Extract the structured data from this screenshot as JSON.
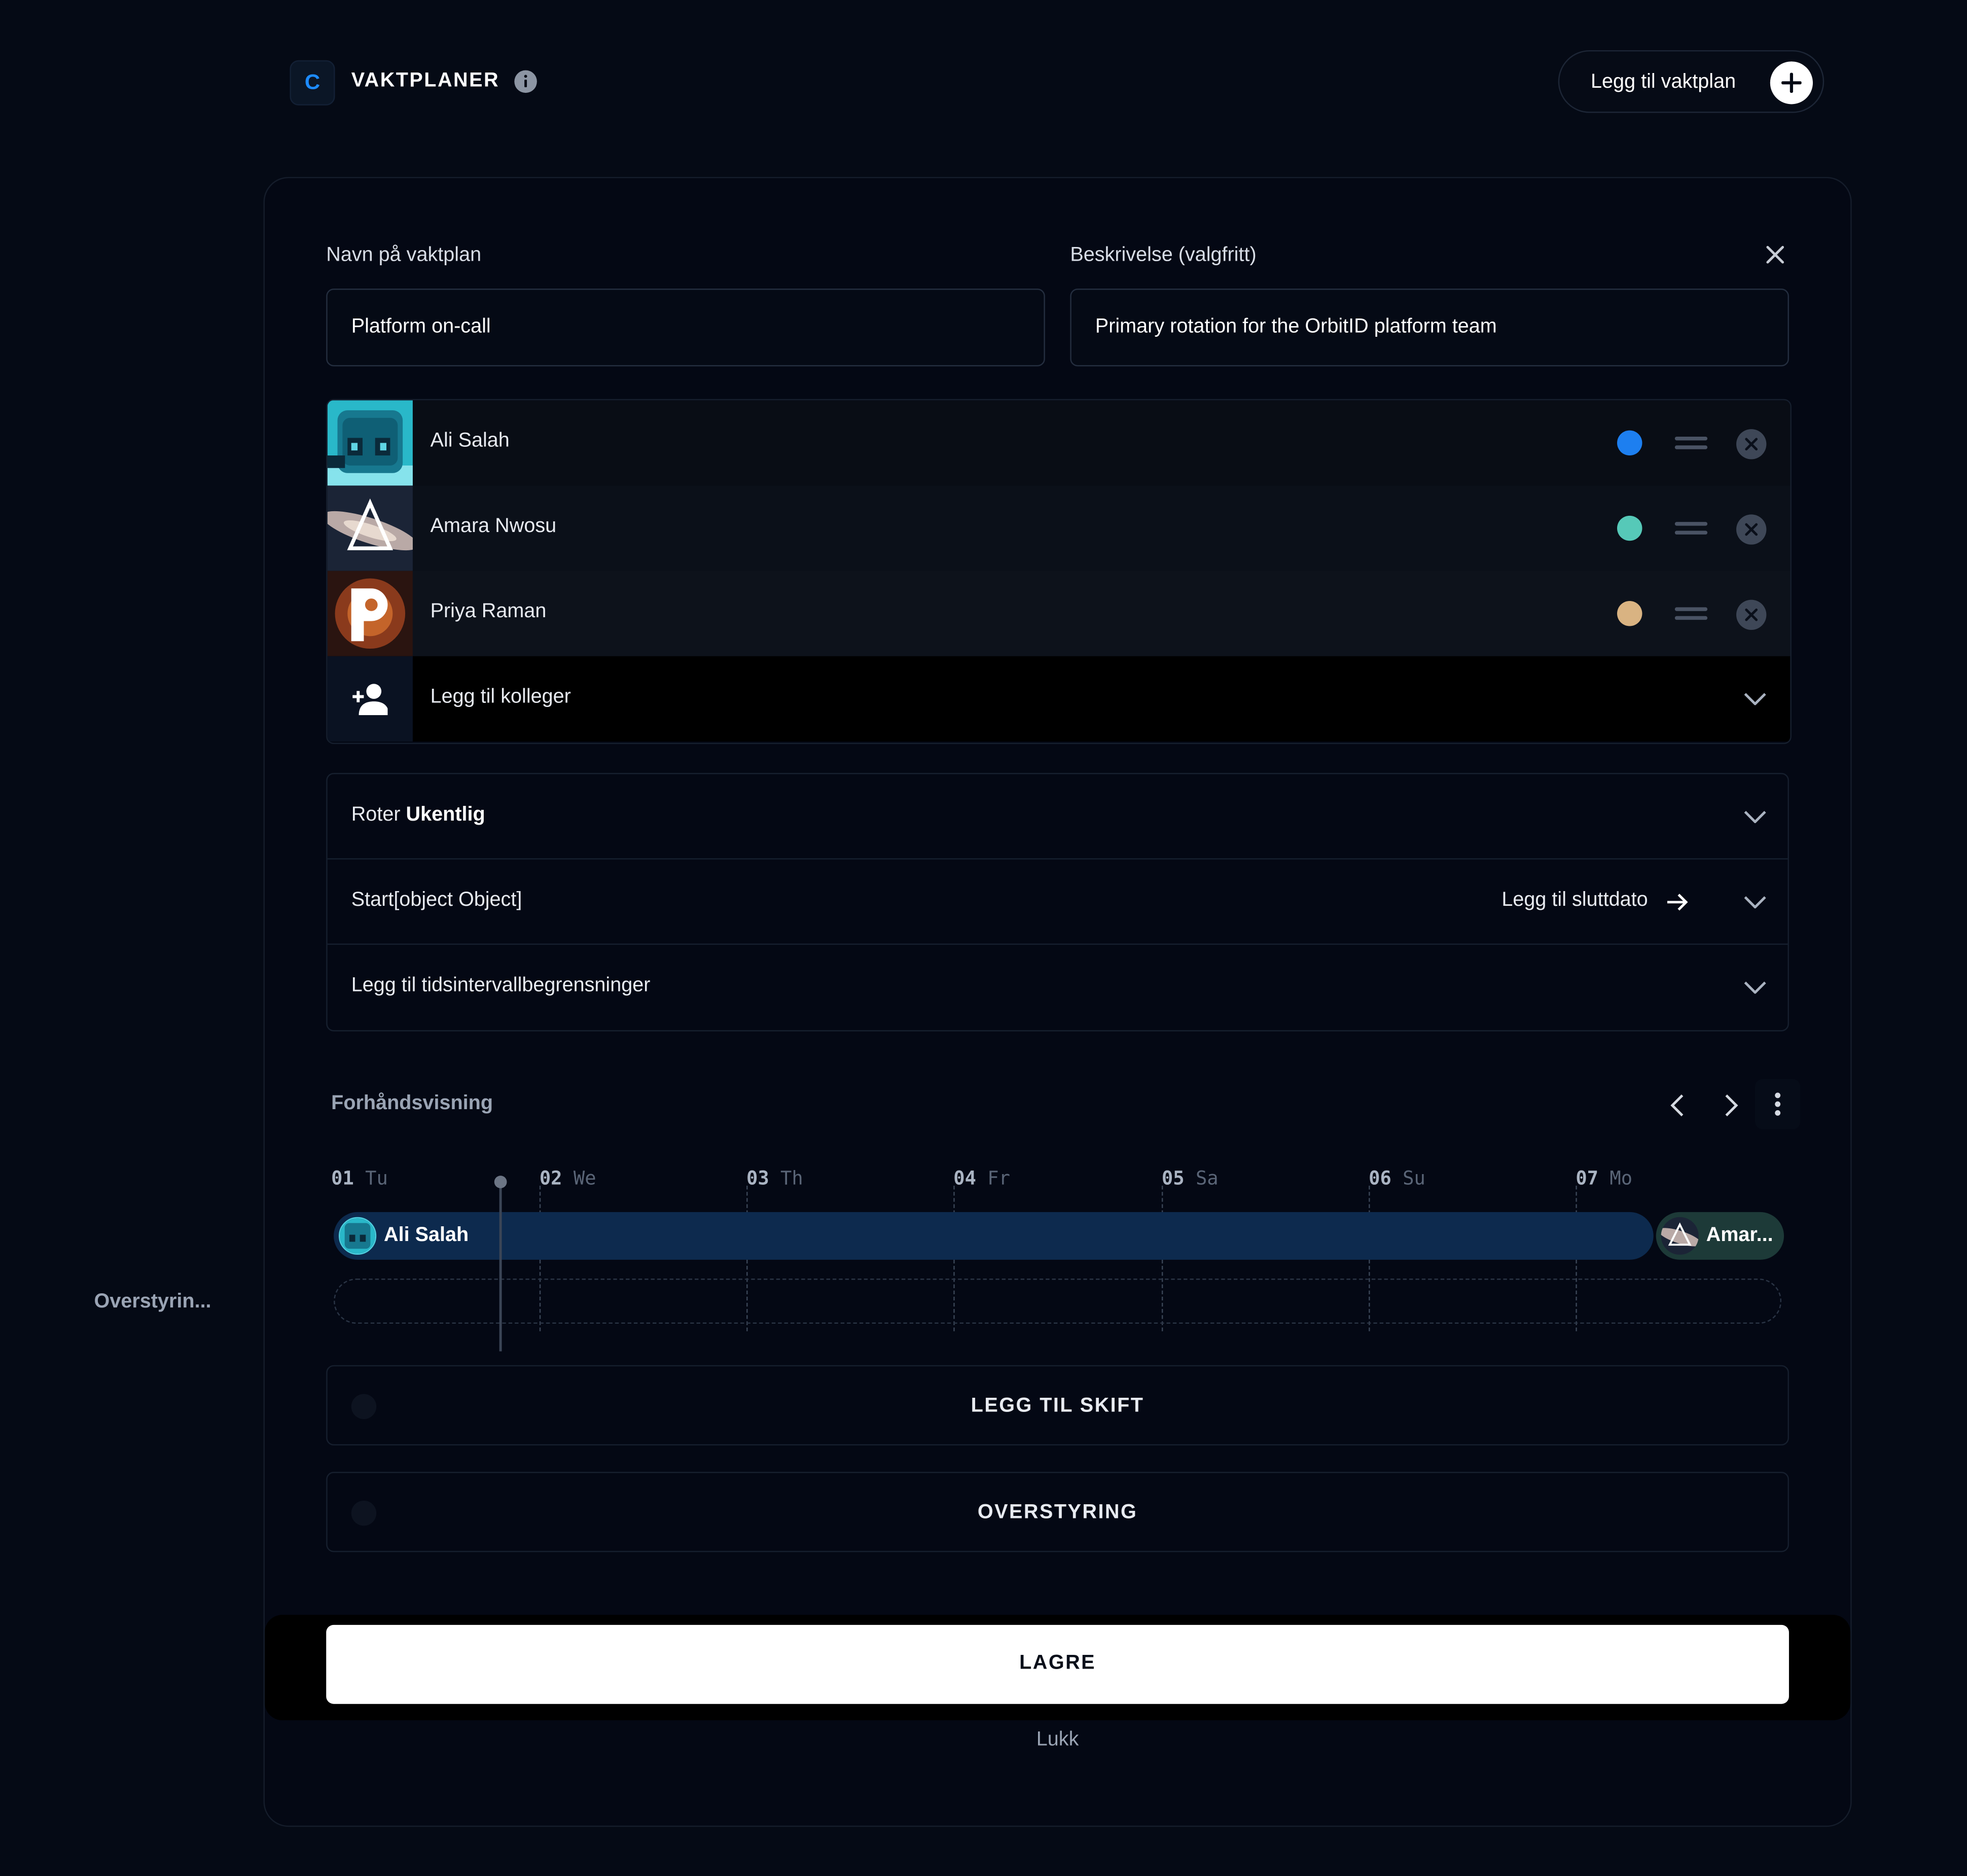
{
  "header": {
    "logo_letter": "C",
    "title": "VAKTPLANER",
    "add_schedule_label": "Legg til vaktplan"
  },
  "form": {
    "name_label": "Navn på vaktplan",
    "name_value": "Platform on-call",
    "description_label": "Beskrivelse (valgfritt)",
    "description_value": "Primary rotation for the OrbitID platform team"
  },
  "members": [
    {
      "name": "Ali Salah",
      "color": "#1d7ff0"
    },
    {
      "name": "Amara Nwosu",
      "color": "#56c9b8"
    },
    {
      "name": "Priya Raman",
      "color": "#d9b382"
    }
  ],
  "add_colleagues_label": "Legg til kolleger",
  "rotation": {
    "prefix": "Roter",
    "value": "Ukentlig"
  },
  "start": {
    "label": "Start[object Object]",
    "end_date_label": "Legg til sluttdato"
  },
  "time_restrictions_label": "Legg til tidsintervallbegrensninger",
  "preview": {
    "title": "Forhåndsvisning",
    "days": [
      {
        "num": "01",
        "name": "Tu"
      },
      {
        "num": "02",
        "name": "We"
      },
      {
        "num": "03",
        "name": "Th"
      },
      {
        "num": "04",
        "name": "Fr"
      },
      {
        "num": "05",
        "name": "Sa"
      },
      {
        "num": "06",
        "name": "Su"
      },
      {
        "num": "07",
        "name": "Mo"
      }
    ],
    "shifts": [
      {
        "name": "Ali Salah"
      },
      {
        "name": "Amar..."
      }
    ]
  },
  "side_label": "Overstyrin...",
  "actions": {
    "add_shift": "LEGG TIL SKIFT",
    "override": "OVERSTYRING",
    "save": "LAGRE",
    "close": "Lukk"
  }
}
